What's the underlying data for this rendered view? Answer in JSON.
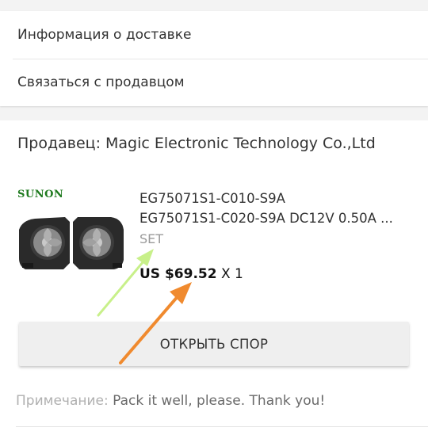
{
  "menu": {
    "delivery_info": "Информация о доставке",
    "contact_seller": "Связаться с продавцом"
  },
  "seller": {
    "label": "Продавец: Magic Electronic Technology Co.,Ltd"
  },
  "product": {
    "brand": "SUNON",
    "title_line1": "EG75071S1-C010-S9A",
    "title_line2": "EG75071S1-C020-S9A DC12V 0.50A ...",
    "variant": "SET",
    "price": "US $69.52",
    "quantity": "X 1"
  },
  "actions": {
    "open_dispute": "ОТКРЫТЬ СПОР"
  },
  "note": {
    "label": "Примечание:",
    "text": "Pack it well, please. Thank you!"
  },
  "colors": {
    "brand_green": "#1f7a1f",
    "arrow_green": "#c8f08a",
    "arrow_orange": "#f08a2e"
  }
}
